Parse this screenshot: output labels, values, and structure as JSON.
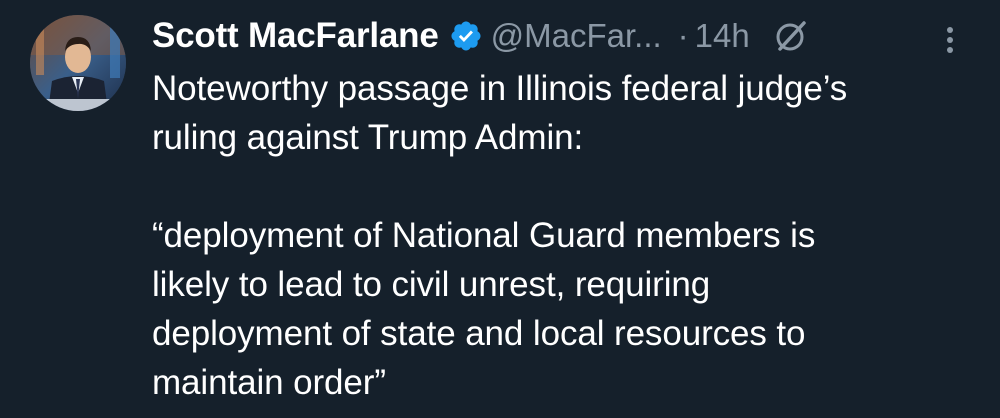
{
  "tweet": {
    "author_name": "Scott MacFarlane",
    "handle": "@MacFar...",
    "separator": "·",
    "time": "14h",
    "verified": true,
    "text": "Noteworthy passage in Illinois federal judge’s\nruling against Trump Admin:\n\n“deployment of National Guard members is\nlikely to lead to civil unrest, requiring\ndeployment of state and local resources to\nmaintain order”"
  },
  "icons": {
    "verified": "verified-badge-icon",
    "grok": "grok-icon",
    "more": "more-options-icon"
  },
  "colors": {
    "background": "#15202b",
    "text": "#ffffff",
    "secondary_text": "#8b98a5",
    "verified_blue": "#1d9bf0"
  }
}
